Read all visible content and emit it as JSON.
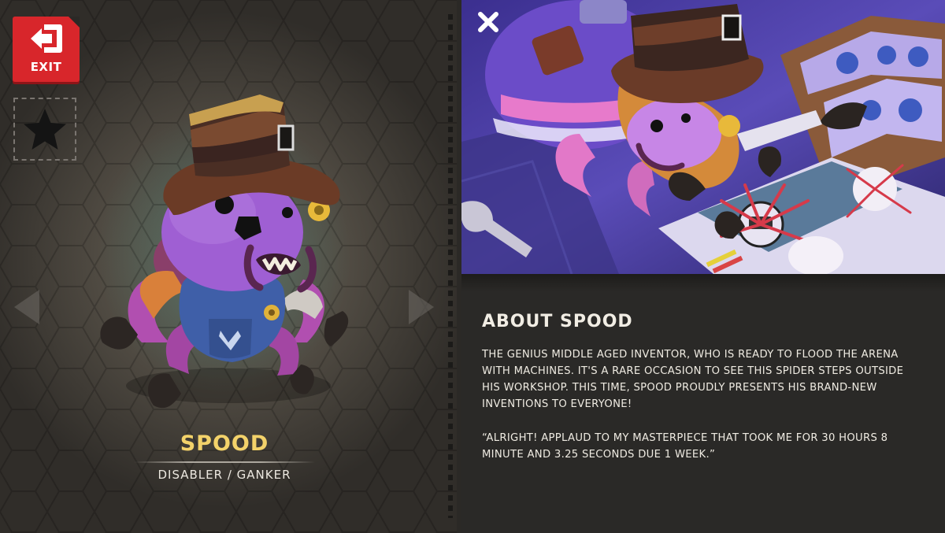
{
  "exit_button": {
    "label": "EXIT",
    "icon": "exit-door-arrow-icon",
    "color": "#d8262b"
  },
  "favorite_button": {
    "icon": "star-icon"
  },
  "navigation": {
    "prev_icon": "chevron-left-icon",
    "next_icon": "chevron-right-icon"
  },
  "hero": {
    "name": "SPOOD",
    "role": "DISABLER / GANKER",
    "name_color": "#f3d26a"
  },
  "splash": {
    "close_icon": "close-icon"
  },
  "about": {
    "title": "ABOUT SPOOD",
    "description": "THE GENIUS MIDDLE AGED INVENTOR, WHO IS READY TO FLOOD THE ARENA\nWITH MACHINES. IT'S A RARE OCCASION TO SEE THIS SPIDER STEPS OUTSIDE\nHIS WORKSHOP. THIS TIME, SPOOD PROUDLY PRESENTS HIS BRAND-NEW\nINVENTIONS TO EVERYONE!",
    "quote": " “ALRIGHT! APPLAUD TO MY MASTERPIECE THAT TOOK ME FOR 30 HOURS 8\nMINUTE AND 3.25 SECONDS DUE 1 WEEK.”"
  }
}
